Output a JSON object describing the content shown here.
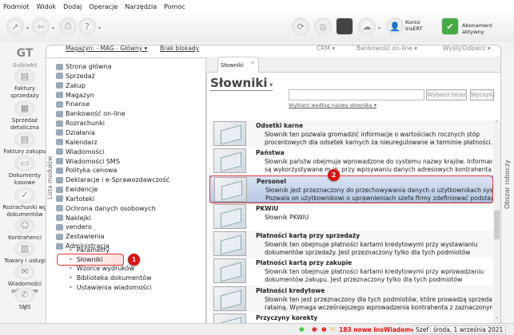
{
  "menu": [
    "Podmiot",
    "Widok",
    "Dodaj",
    "Operacje",
    "Narzędzia",
    "Pomoc"
  ],
  "toolbar": {
    "account_label_1": "Konto",
    "account_label_2": "InsERT",
    "subscription": "Abonament aktywny"
  },
  "logo_text": "Subiekt",
  "left_nav": [
    "Faktury sprzedaży",
    "Sprzedaż detaliczna",
    "Faktury zakupu",
    "Dokumenty kasowe",
    "Rozrachunki wg dokumentów",
    "Kontrahenci",
    "Towary i usługi",
    "Wiadomości odebrane",
    "SMS"
  ],
  "topbar": {
    "warehouse": "Magazyn: - MAG - Główny ▾",
    "lock": "Brak blokady",
    "crm": "CRM ▾",
    "banking": "Bankowość on-line ▾",
    "send": "Wyślij/Odbierz ▾"
  },
  "modules_label": "Lista modułów",
  "modules": [
    "Strona główna",
    "Sprzedaż",
    "Zakup",
    "Magazyn",
    "Finanse",
    "Bankowość on-line",
    "Rozrachunki",
    "Działania",
    "Kalendarz",
    "Wiadomości",
    "Wiadomości SMS",
    "Polityka cenowa",
    "Deklaracje i e-Sprawozdawczość",
    "Ewidencje",
    "Kartoteki",
    "Ochrona danych osobowych",
    "Naklejki",
    "vendero",
    "Zestawienia",
    "Administracja"
  ],
  "admin_sub": [
    "Parametry",
    "Słowniki",
    "Wzorce wydruków",
    "Biblioteka dokumentów",
    "Ustawienia wiadomości"
  ],
  "callouts": [
    "1",
    "2"
  ],
  "tab": {
    "label": "Słowniki",
    "close": "✕"
  },
  "heading": "Słowniki",
  "search": {
    "value": "",
    "select_btn": "Wybierz teraz",
    "clear_btn": "Wyczyść",
    "by_name": "Wybierz według nazwy słownika ▾"
  },
  "dictionaries": [
    {
      "title": "Odsetki karne",
      "desc": [
        "Słownik ten pozwala gromadzić informacje o wartościach rocznych stóp",
        "procentowych dla odsetek karnych za nieuregulowane w terminie płatności. Jest"
      ]
    },
    {
      "title": "Państwa",
      "desc": [
        "Słownik państw obejmuje wprowadzone do systemu nazwy krajów. Informacje te",
        "są wykorzystywane m.in. przy wpisywaniu danych adresowych kontrahenta."
      ]
    },
    {
      "title": "Personel",
      "desc": [
        "Słownik jest przeznaczony do przechowywania danych o użytkownikach systemu.",
        "Pozwala on użytkownikowi o uprawnieniach szefa firmy zdefiniować podstawowe"
      ]
    },
    {
      "title": "PKWiU",
      "desc": [
        "Słownik PKWiU",
        ""
      ]
    },
    {
      "title": "Płatności kartą przy sprzedaży",
      "desc": [
        "Słownik ten obejmuje płatności kartami kredytowymi przy wystawianiu",
        "dokumentów sprzedaży. Jest przeznaczony tylko dla tych podmiotów"
      ]
    },
    {
      "title": "Płatności kartą przy zakupie",
      "desc": [
        "Słownik ten obejmuje płatności kartami kredytowymi przy wprowadzaniu",
        "dokumentów zakupu. Jest przeznaczony tylko dla tych podmiotów"
      ]
    },
    {
      "title": "Płatności kredytowe",
      "desc": [
        "Słownik ten jest przeznaczony dla tych podmiotów, które prowadzą sprzedaż",
        "ratalną. Wymaga wcześniejszego wprowadzenia kontrahenta z zaznaczonym"
      ]
    },
    {
      "title": "Przyczyny korekty",
      "desc": [
        "",
        ""
      ]
    }
  ],
  "workspace_label": "Obszar roboczy",
  "status": {
    "messages": "183 nowe InsWiadomości",
    "user": "Szef",
    "date": "środa, 1 września 2021"
  },
  "colors": {
    "accent": "#dd1111",
    "selection": "#b7c9e4"
  }
}
